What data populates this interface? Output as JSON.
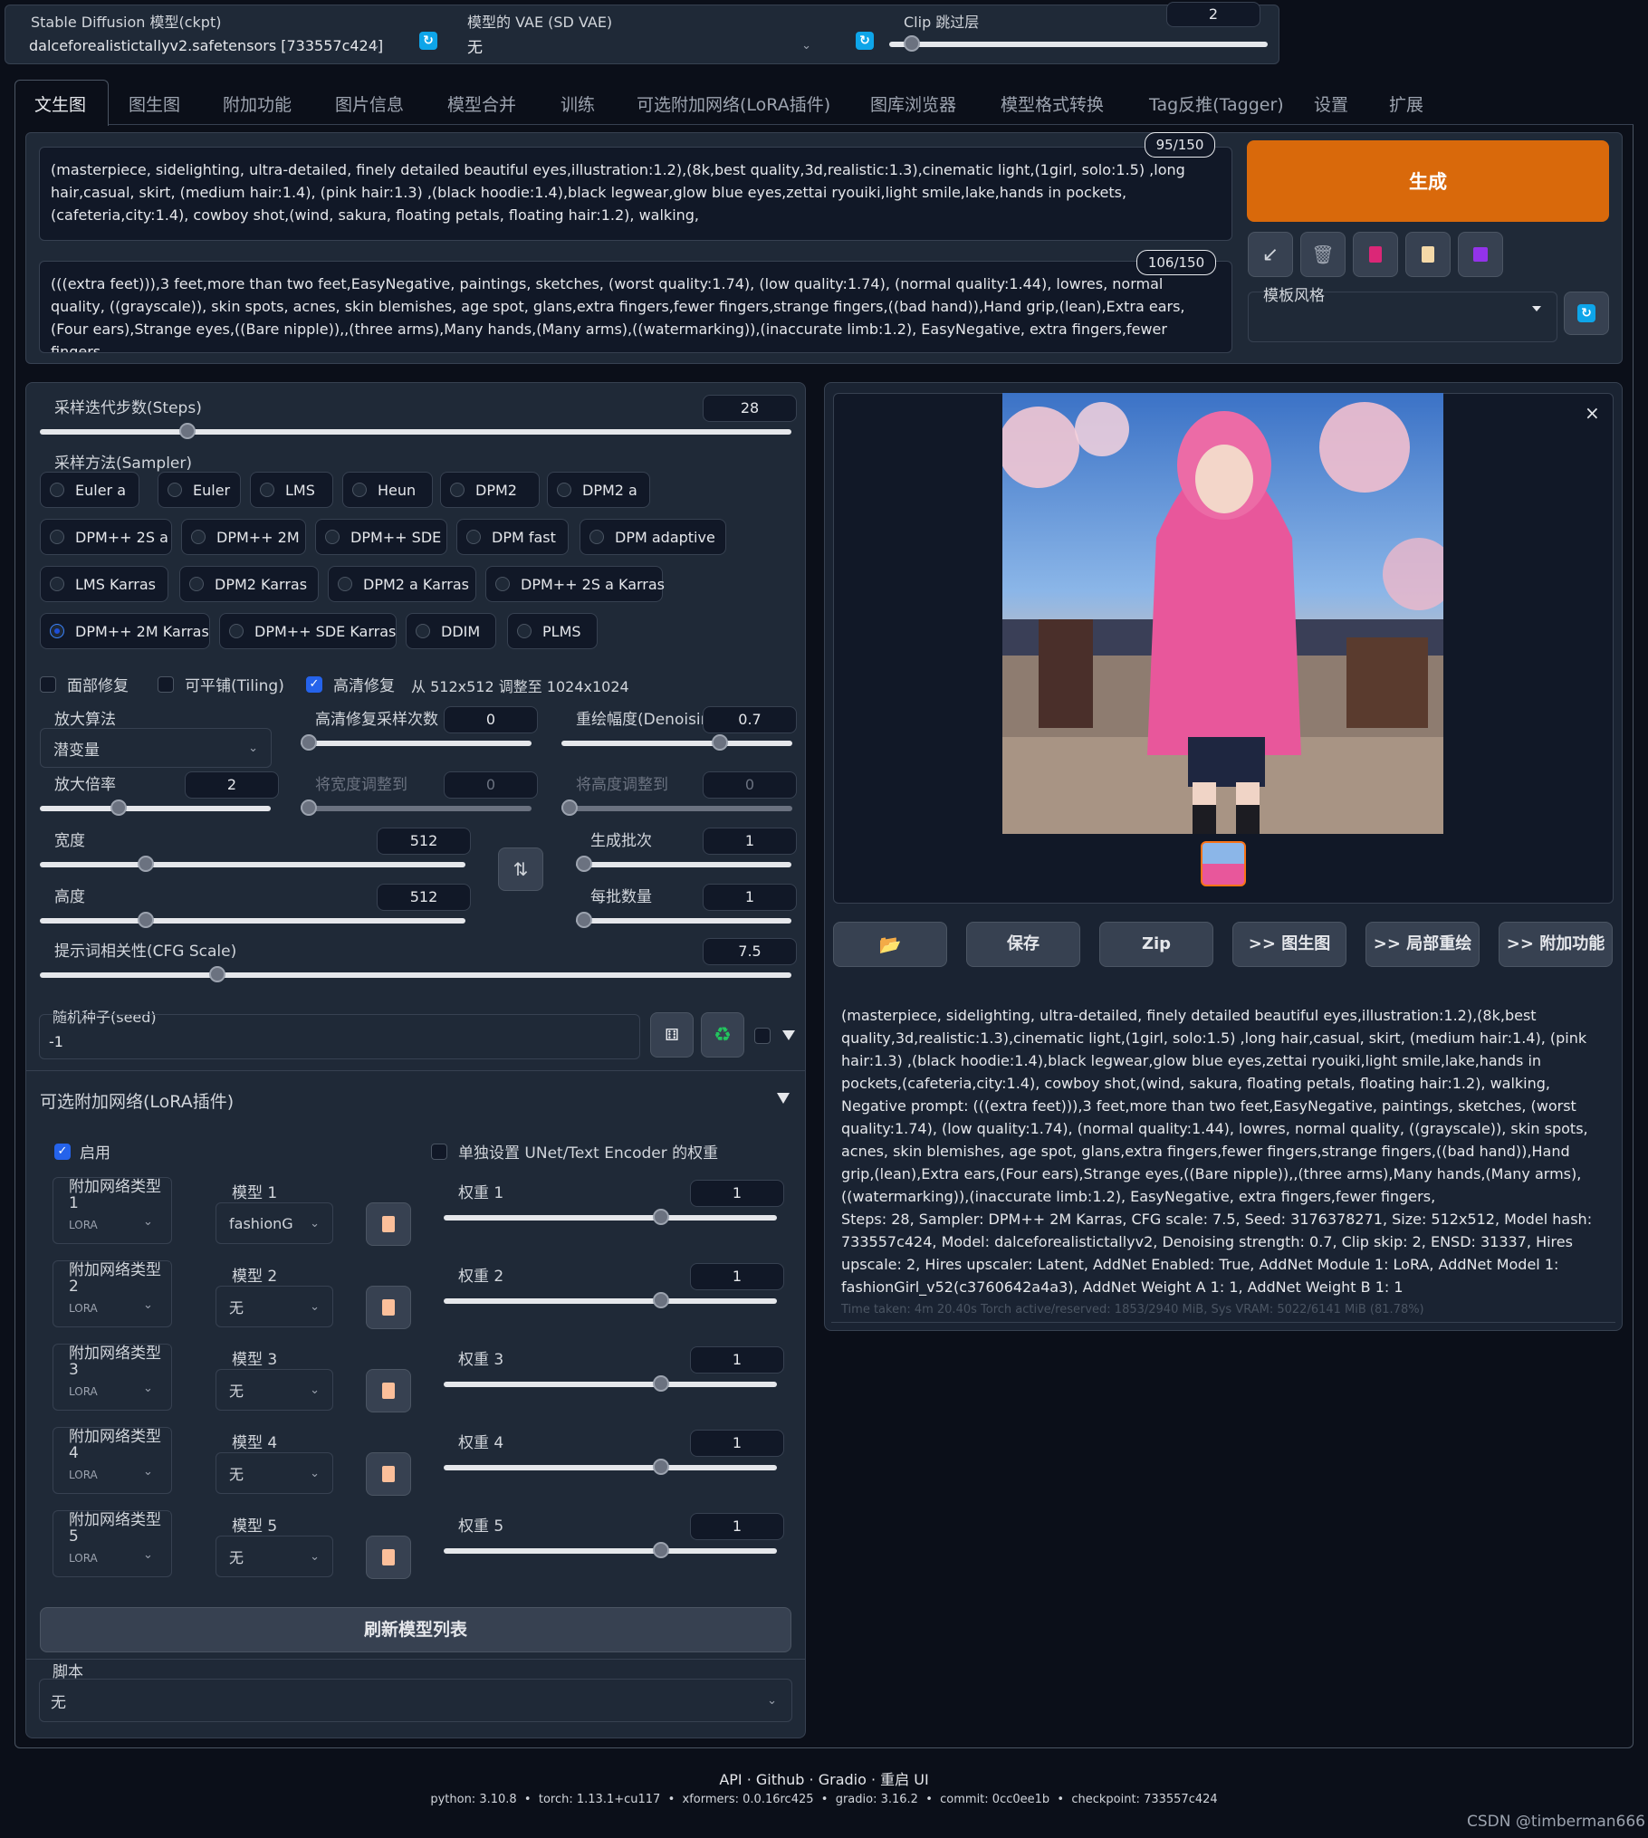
{
  "topbar": {
    "ckpt_label": "Stable Diffusion 模型(ckpt)",
    "ckpt_value": "dalceforealistictallyv2.safetensors [733557c424]",
    "vae_label": "模型的 VAE (SD VAE)",
    "vae_value": "无",
    "clip_label": "Clip 跳过层",
    "clip_value": "2",
    "clip_fraction": 0.04
  },
  "tabs": [
    "文生图",
    "图生图",
    "附加功能",
    "图片信息",
    "模型合并",
    "训练",
    "可选附加网络(LoRA插件)",
    "图库浏览器",
    "模型格式转换",
    "Tag反推(Tagger)",
    "设置",
    "扩展"
  ],
  "prompt": {
    "positive": "(masterpiece, sidelighting, ultra-detailed, finely detailed beautiful eyes,illustration:1.2),(8k,best quality,3d,realistic:1.3),cinematic light,(1girl, solo:1.5) ,long hair,casual, skirt, (medium hair:1.4), (pink hair:1.3) ,(black hoodie:1.4),black legwear,glow blue eyes,zettai ryouiki,light smile,lake,hands in pockets,(cafeteria,city:1.4), cowboy shot,(wind, sakura, floating petals, floating hair:1.2), walking,",
    "positive_count": "95/150",
    "negative": "(((extra feet))),3 feet,more than two feet,EasyNegative, paintings, sketches, (worst quality:1.74), (low quality:1.74), (normal quality:1.44), lowres, normal quality, ((grayscale)), skin spots, acnes, skin blemishes, age spot, glans,extra fingers,fewer fingers,strange fingers,((bad hand)),Hand grip,(lean),Extra ears,(Four ears),Strange eyes,((Bare nipple)),,(three arms),Many hands,(Many arms),((watermarking)),(inaccurate limb:1.2), EasyNegative, extra fingers,fewer fingers,",
    "negative_count": "106/150"
  },
  "generate": {
    "label": "生成",
    "style_label": "模板风格",
    "color": "#d9690b"
  },
  "params": {
    "steps_label": "采样迭代步数(Steps)",
    "steps": "28",
    "steps_fraction": 0.19,
    "sampler_label": "采样方法(Sampler)",
    "samplers": [
      [
        "Euler a",
        "Euler",
        "LMS",
        "Heun",
        "DPM2",
        "DPM2 a"
      ],
      [
        "DPM++ 2S a",
        "DPM++ 2M",
        "DPM++ SDE",
        "DPM fast",
        "DPM adaptive"
      ],
      [
        "LMS Karras",
        "DPM2 Karras",
        "DPM2 a Karras",
        "DPM++ 2S a Karras"
      ],
      [
        "DPM++ 2M Karras",
        "DPM++ SDE Karras",
        "DDIM",
        "PLMS"
      ]
    ],
    "sampler_selected": "DPM++ 2M Karras",
    "face_restore": "面部修复",
    "tiling": "可平铺(Tiling)",
    "hires": "高清修复",
    "hires_note": "从 512x512 调整至 1024x1024",
    "upscaler_label": "放大算法",
    "upscaler": "潜变量",
    "hires_steps_label": "高清修复采样次数",
    "hires_steps": "0",
    "denoise_label": "重绘幅度(Denoising",
    "denoise": "0.7",
    "denoise_fraction": 0.7,
    "scale_label": "放大倍率",
    "scale": "2",
    "scale_fraction": 0.33,
    "resize_w_label": "将宽度调整到",
    "resize_w": "0",
    "resize_h_label": "将高度调整到",
    "resize_h": "0",
    "width_label": "宽度",
    "width": "512",
    "width_fraction": 0.24,
    "height_label": "高度",
    "height": "512",
    "height_fraction": 0.24,
    "batch_count_label": "生成批次",
    "batch_count": "1",
    "batch_size_label": "每批数量",
    "batch_size": "1",
    "cfg_label": "提示词相关性(CFG Scale)",
    "cfg": "7.5",
    "cfg_fraction": 0.23,
    "seed_label": "随机种子(seed)",
    "seed": "-1"
  },
  "lora": {
    "title": "可选附加网络(LoRA插件)",
    "enable": "启用",
    "separate": "单独设置 UNet/Text Encoder 的权重",
    "rows": [
      {
        "type_label": "附加网络类型 1",
        "type": "LoRA",
        "model_label": "模型 1",
        "model": "fashionG",
        "weight_label": "权重 1",
        "weight": "1",
        "weight_fraction": 0.66
      },
      {
        "type_label": "附加网络类型 2",
        "type": "LoRA",
        "model_label": "模型 2",
        "model": "无",
        "weight_label": "权重 2",
        "weight": "1",
        "weight_fraction": 0.66
      },
      {
        "type_label": "附加网络类型 3",
        "type": "LoRA",
        "model_label": "模型 3",
        "model": "无",
        "weight_label": "权重 3",
        "weight": "1",
        "weight_fraction": 0.66
      },
      {
        "type_label": "附加网络类型 4",
        "type": "LoRA",
        "model_label": "模型 4",
        "model": "无",
        "weight_label": "权重 4",
        "weight": "1",
        "weight_fraction": 0.66
      },
      {
        "type_label": "附加网络类型 5",
        "type": "LoRA",
        "model_label": "模型 5",
        "model": "无",
        "weight_label": "权重 5",
        "weight": "1",
        "weight_fraction": 0.66
      }
    ],
    "refresh": "刷新模型列表"
  },
  "script": {
    "label": "脚本",
    "value": "无"
  },
  "output": {
    "buttons": [
      "保存",
      "Zip",
      ">> 图生图",
      ">> 局部重绘",
      ">> 附加功能"
    ],
    "info": "(masterpiece, sidelighting, ultra-detailed, finely detailed beautiful eyes,illustration:1.2),(8k,best quality,3d,realistic:1.3),cinematic light,(1girl, solo:1.5) ,long hair,casual, skirt, (medium hair:1.4), (pink hair:1.3) ,(black hoodie:1.4),black legwear,glow blue eyes,zettai ryouiki,light smile,lake,hands in pockets,(cafeteria,city:1.4), cowboy shot,(wind, sakura, floating petals, floating hair:1.2), walking,",
    "negative_info": "Negative prompt: (((extra feet))),3 feet,more than two feet,EasyNegative, paintings, sketches, (worst quality:1.74), (low quality:1.74), (normal quality:1.44), lowres, normal quality, ((grayscale)), skin spots, acnes, skin blemishes, age spot, glans,extra fingers,fewer fingers,strange fingers,((bad hand)),Hand grip,(lean),Extra ears,(Four ears),Strange eyes,((Bare nipple)),,(three arms),Many hands,(Many arms),((watermarking)),(inaccurate limb:1.2), EasyNegative, extra fingers,fewer fingers,",
    "params_info": "Steps: 28, Sampler: DPM++ 2M Karras, CFG scale: 7.5, Seed: 3176378271, Size: 512x512, Model hash: 733557c424, Model: dalceforealistictallyv2, Denoising strength: 0.7, Clip skip: 2, ENSD: 31337, Hires upscale: 2, Hires upscaler: Latent, AddNet Enabled: True, AddNet Module 1: LoRA, AddNet Model 1: fashionGirl_v52(c3760642a4a3), AddNet Weight A 1: 1, AddNet Weight B 1: 1",
    "time_info": "Time taken: 4m 20.40s  Torch active/reserved: 1853/2940 MiB, Sys VRAM: 5022/6141 MiB (81.78%)"
  },
  "footer": {
    "links": "API · Github · Gradio · 重启 UI",
    "versions": "python: 3.10.8  •  torch: 1.13.1+cu117  •  xformers: 0.0.16rc425  •  gradio: 3.16.2  •  commit: 0cc0ee1b  •  checkpoint: 733557c424",
    "watermark": "CSDN @timberman666"
  }
}
